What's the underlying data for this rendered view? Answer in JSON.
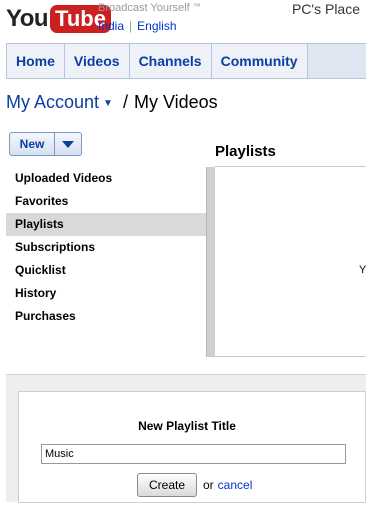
{
  "header": {
    "logo_you": "You",
    "logo_tube": "Tube",
    "tagline": "Broadcast Yourself",
    "trademark": "™",
    "country_link": "India",
    "language_link": "English",
    "user": "PC's Place"
  },
  "nav": {
    "tabs": [
      {
        "label": "Home"
      },
      {
        "label": "Videos"
      },
      {
        "label": "Channels"
      },
      {
        "label": "Community"
      }
    ]
  },
  "breadcrumb": {
    "account": "My Account",
    "separator": "/",
    "current": "My Videos"
  },
  "new_button": {
    "label": "New"
  },
  "content": {
    "heading": "Playlists",
    "clipped_text": "Y"
  },
  "sidebar": {
    "items": [
      {
        "label": "Uploaded Videos",
        "selected": false
      },
      {
        "label": "Favorites",
        "selected": false
      },
      {
        "label": "Playlists",
        "selected": true
      },
      {
        "label": "Subscriptions",
        "selected": false
      },
      {
        "label": "Quicklist",
        "selected": false
      },
      {
        "label": "History",
        "selected": false
      },
      {
        "label": "Purchases",
        "selected": false
      }
    ]
  },
  "new_playlist": {
    "title": "New Playlist Title",
    "input_value": "Music",
    "create_label": "Create",
    "or_text": "or",
    "cancel_label": "cancel"
  },
  "colors": {
    "logo_red": "#cc1f1f",
    "link_blue": "#0033cc",
    "nav_text": "#0b3ea1",
    "selection_gray": "#d9d9d9"
  }
}
